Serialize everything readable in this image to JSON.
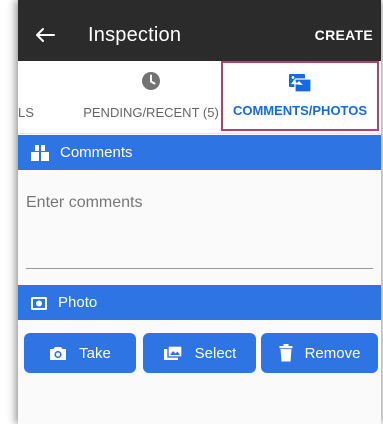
{
  "appbar": {
    "title": "Inspection",
    "action": "CREATE"
  },
  "tabs": [
    {
      "label": "LS",
      "icon": "partial-tab"
    },
    {
      "label": "PENDING/RECENT (5)",
      "icon": "clock-icon"
    },
    {
      "label": "COMMENTS/PHOTOS",
      "icon": "photos-icon",
      "active": true
    }
  ],
  "comments": {
    "header": "Comments",
    "placeholder": "Enter comments",
    "value": ""
  },
  "photo": {
    "header": "Photo",
    "buttons": [
      {
        "label": "Take",
        "icon": "camera-icon"
      },
      {
        "label": "Select",
        "icon": "gallery-icon"
      },
      {
        "label": "Remove",
        "icon": "trash-icon"
      }
    ]
  },
  "colors": {
    "appbar": "#2b2b2b",
    "accent": "#2f74e3",
    "active_tab_text": "#1769e0",
    "active_tab_border": "#b2446b"
  }
}
